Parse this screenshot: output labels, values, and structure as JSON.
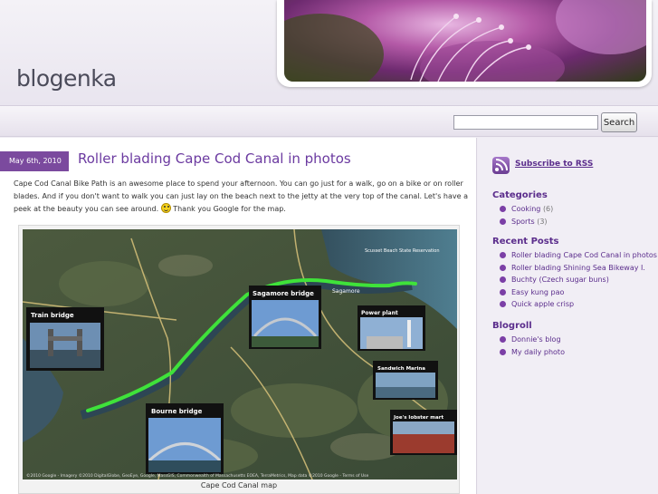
{
  "header": {
    "blog_title": "blogenka"
  },
  "search": {
    "input_value": "",
    "button_label": "Search"
  },
  "post": {
    "date": "May 6th, 2010",
    "title": "Roller blading Cape Cod Canal in photos",
    "body_part1": "Cape Cod Canal Bike Path is an awesome place to spend your afternoon. You can go just for a walk, go on a bike or on roller blades. And if you don't want to walk you can just lay on the beach next to the jetty at the very top of the canal. Let's have a peek at the beauty you can see around. ",
    "body_part2": " Thank you Google for the map.",
    "map_caption": "Cape Cod Canal map",
    "map_labels": {
      "train_bridge": "Train bridge",
      "sagamore_bridge": "Sagamore bridge",
      "power_plant": "Power plant",
      "sandwich_marina": "Sandwich Marina",
      "bourne_bridge": "Bourne bridge",
      "joes_lobster_mart": "Joe's lobster mart",
      "place_sagamore": "Sagamore",
      "place_scusset": "Scusset Beach State Reservation",
      "copyright": "©2010 Google - Imagery ©2010 DigitalGlobe, GeoEye, Google, MassGIS, Commonwealth of Massachusetts EOEA, TerraMetrics, Map data ©2010 Google - Terms of Use"
    }
  },
  "sidebar": {
    "rss_label": "Subscribe to RSS",
    "categories_title": "Categories",
    "categories": [
      {
        "name": "Cooking",
        "count": "(6)"
      },
      {
        "name": "Sports",
        "count": "(3)"
      }
    ],
    "recent_title": "Recent Posts",
    "recent_posts": [
      "Roller blading Cape Cod Canal in photos",
      "Roller blading Shining Sea Bikeway I.",
      "Buchty (Czech sugar buns)",
      "Easy kung pao",
      "Quick apple crisp"
    ],
    "blogroll_title": "Blogroll",
    "blogroll": [
      "Donnie's blog",
      "My daily photo"
    ]
  },
  "colors": {
    "accent": "#6b3aa0",
    "date_badge": "#7b4a9e",
    "route": "#3fe23a"
  }
}
